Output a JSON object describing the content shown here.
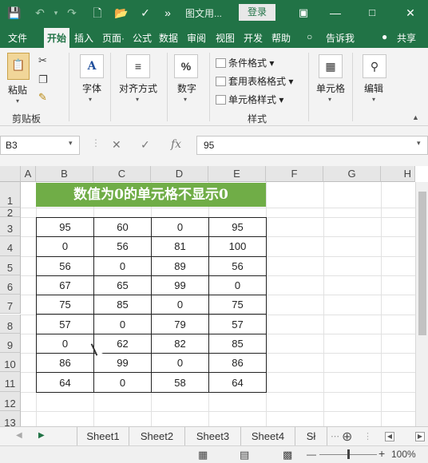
{
  "titlebar": {
    "doc_title": "图文用...",
    "login": "登录",
    "more": "»"
  },
  "tabs": [
    "文件",
    "开始",
    "插入",
    "页面·",
    "公式",
    "数据",
    "审阅",
    "视图",
    "开发",
    "帮助",
    "告诉我",
    "共享"
  ],
  "ribbon": {
    "clipboard": {
      "paste": "粘贴",
      "group": "剪贴板"
    },
    "font": {
      "label": "字体",
      "icon_text": "A"
    },
    "align": {
      "label": "对齐方式"
    },
    "number": {
      "label": "数字",
      "icon_text": "%"
    },
    "styles": {
      "cond": "条件格式",
      "table": "套用表格格式",
      "cell": "单元格样式",
      "group": "样式"
    },
    "cells": {
      "label": "单元格"
    },
    "edit": {
      "label": "编辑"
    }
  },
  "formula_bar": {
    "name_box": "B3",
    "value": "95",
    "fx": "fx"
  },
  "columns": [
    "A",
    "B",
    "C",
    "D",
    "E",
    "F",
    "G",
    "H"
  ],
  "rows": [
    "1",
    "2",
    "3",
    "4",
    "5",
    "6",
    "7",
    "8",
    "9",
    "10",
    "11",
    "12",
    "13"
  ],
  "banner_text": "数值为0的单元格不显示0",
  "table": [
    [
      "95",
      "60",
      "0",
      "95"
    ],
    [
      "0",
      "56",
      "81",
      "100"
    ],
    [
      "56",
      "0",
      "89",
      "56"
    ],
    [
      "67",
      "65",
      "99",
      "0"
    ],
    [
      "75",
      "85",
      "0",
      "75"
    ],
    [
      "57",
      "0",
      "79",
      "57"
    ],
    [
      "0",
      "62",
      "82",
      "85"
    ],
    [
      "86",
      "99",
      "0",
      "86"
    ],
    [
      "64",
      "0",
      "58",
      "64"
    ]
  ],
  "sheets": [
    "Sheet1",
    "Sheet2",
    "Sheet3",
    "Sheet4",
    "Sł"
  ],
  "status": {
    "zoom": "100%"
  },
  "colors": {
    "accent": "#217346",
    "banner": "#70ad47"
  }
}
